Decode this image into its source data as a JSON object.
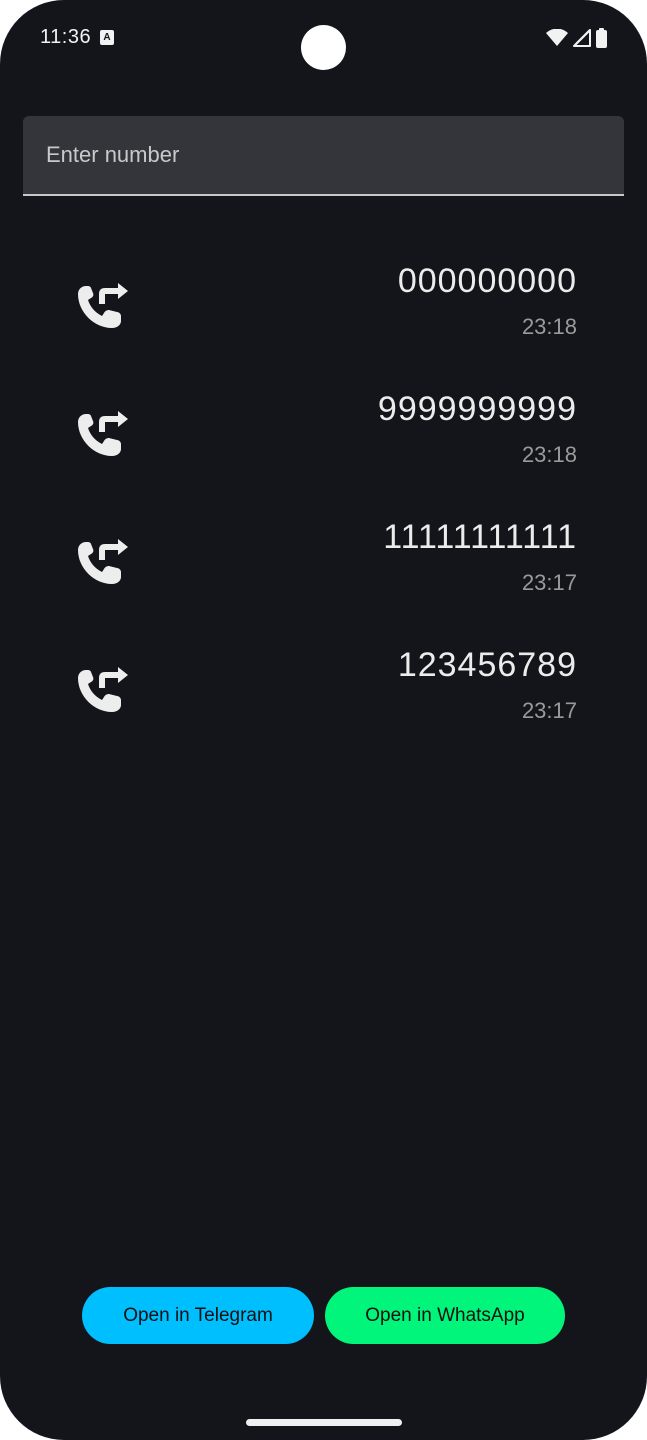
{
  "status_bar": {
    "time": "11:36",
    "notification_icon": "a-icon",
    "icons": [
      "wifi-icon",
      "signal-icon",
      "battery-icon"
    ]
  },
  "search": {
    "placeholder": "Enter number",
    "value": ""
  },
  "calls": [
    {
      "number": "000000000",
      "time": "23:18",
      "icon": "outgoing-call-icon"
    },
    {
      "number": "9999999999",
      "time": "23:18",
      "icon": "outgoing-call-icon"
    },
    {
      "number": "11111111111",
      "time": "23:17",
      "icon": "outgoing-call-icon"
    },
    {
      "number": "123456789",
      "time": "23:17",
      "icon": "outgoing-call-icon"
    }
  ],
  "buttons": {
    "telegram": {
      "label": "Open in Telegram",
      "color": "#00bfff"
    },
    "whatsapp": {
      "label": "Open in WhatsApp",
      "color": "#00f57a"
    }
  },
  "colors": {
    "background": "#14151a",
    "input_background": "#34353b",
    "primary_text": "#ececec",
    "secondary_text": "#9a9a9a"
  }
}
